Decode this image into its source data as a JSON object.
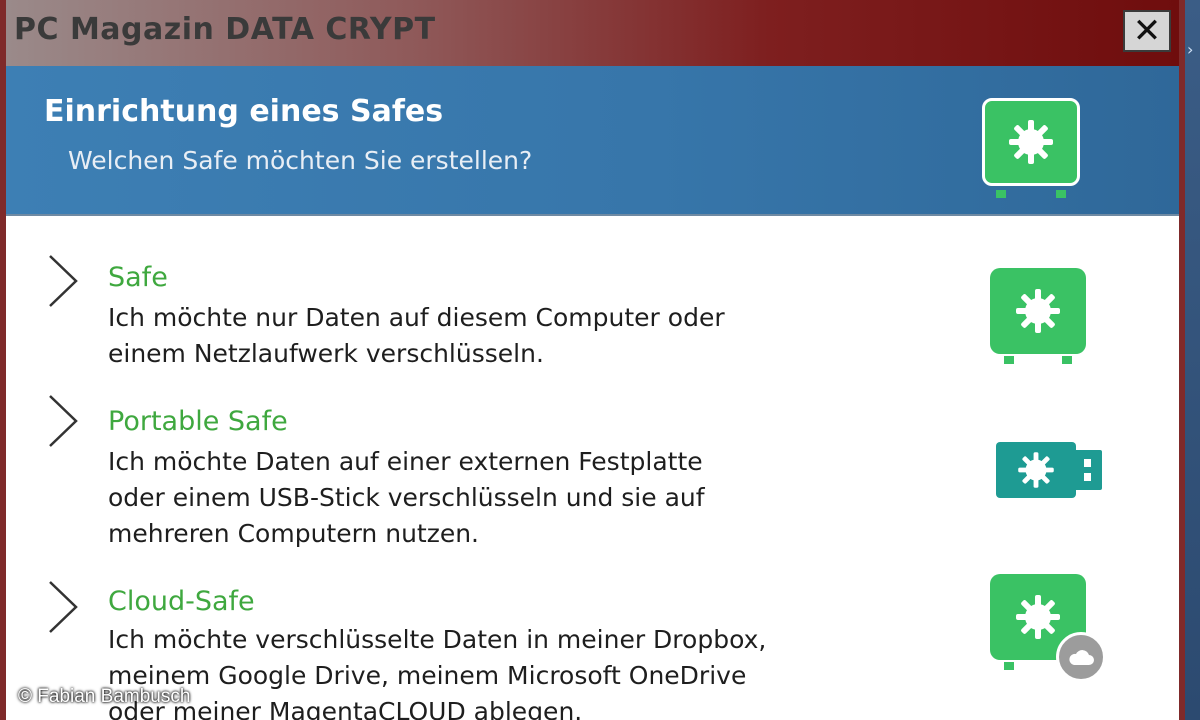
{
  "window": {
    "title": "PC Magazin DATA CRYPT",
    "close_label": "✕"
  },
  "header": {
    "title": "Einrichtung eines Safes",
    "subtitle": "Welchen Safe möchten Sie erstellen?",
    "icon": "safe-icon"
  },
  "options": [
    {
      "title": "Safe",
      "desc": [
        "Ich möchte nur Daten auf diesem Computer oder",
        "einem Netzlaufwerk verschlüsseln."
      ],
      "icon": "safe-icon"
    },
    {
      "title": "Portable Safe",
      "desc": [
        "Ich möchte Daten auf einer externen Festplatte",
        "oder einem USB-Stick verschlüsseln und sie auf",
        "mehreren Computern nutzen."
      ],
      "icon": "usb-safe-icon"
    },
    {
      "title": "Cloud-Safe",
      "desc": [
        "Ich möchte verschlüsselte Daten in meiner Dropbox,",
        "meinem Google Drive, meinem Microsoft OneDrive",
        "oder meiner MagentaCLOUD ablegen."
      ],
      "icon": "cloud-safe-icon"
    }
  ],
  "copyright": "© Fabian Bambusch",
  "colors": {
    "accent_green": "#3ac264",
    "title_green": "#3fa83f",
    "usb_teal": "#1e9b93",
    "header_blue": "#3776aa",
    "titlebar_red": "#7e1f1f"
  }
}
